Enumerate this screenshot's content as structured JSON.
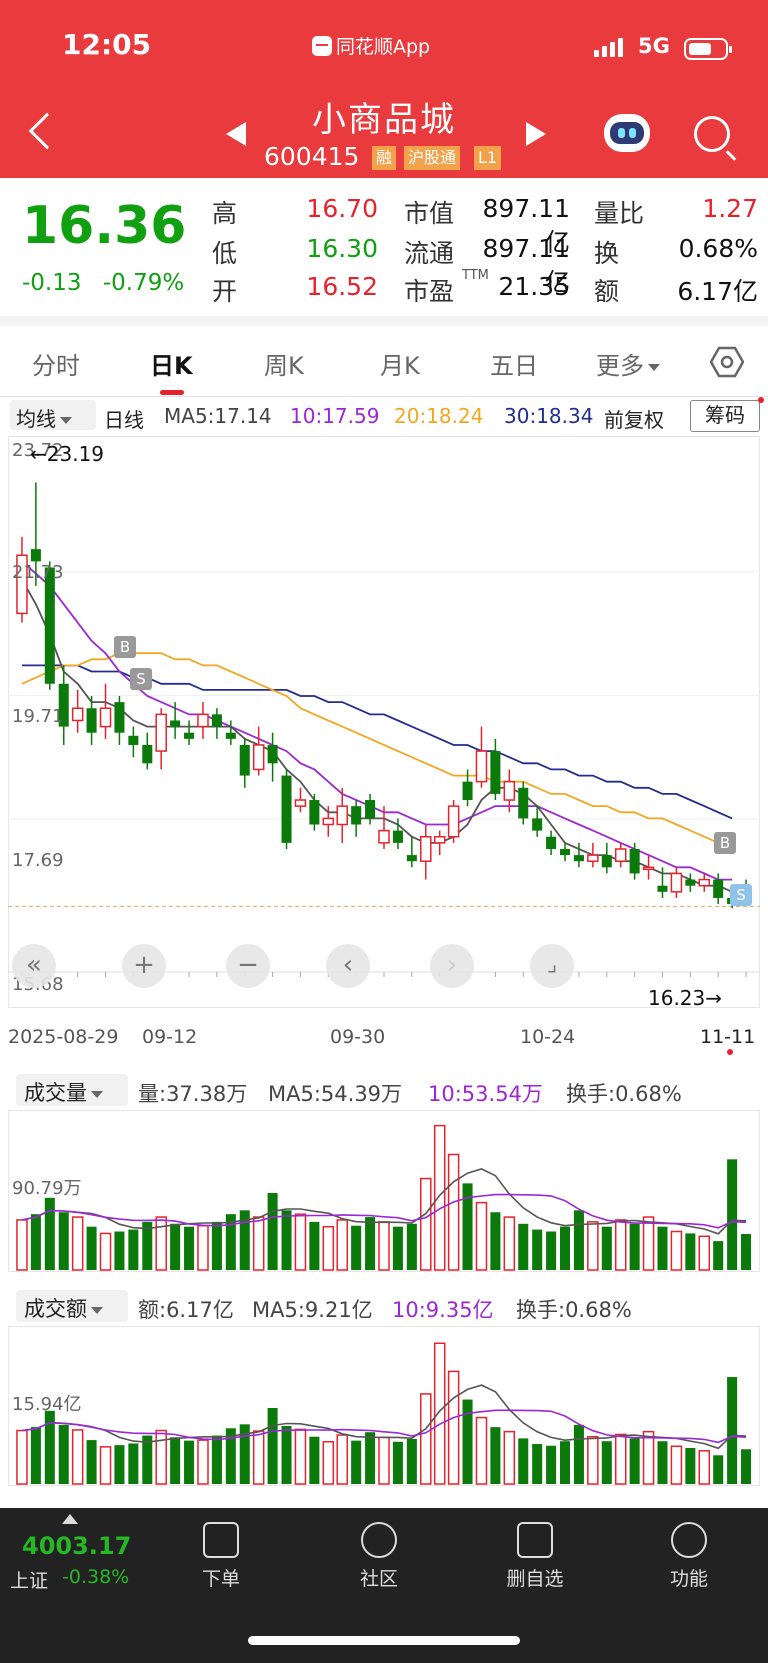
{
  "status": {
    "time": "12:05",
    "app": "同花顺App",
    "network": "5G"
  },
  "header": {
    "name": "小商品城",
    "code": "600415",
    "tags": [
      "融",
      "沪股通",
      "L1"
    ]
  },
  "quote": {
    "price": "16.36",
    "change": "-0.13",
    "pct": "-0.79%",
    "high_l": "高",
    "high": "16.70",
    "low_l": "低",
    "low": "16.30",
    "open_l": "开",
    "open": "16.52",
    "mcap_l": "市值",
    "mcap": "897.11亿",
    "float_l": "流通",
    "float": "897.11亿",
    "pe_l": "市盈",
    "pe_sup": "TTM",
    "pe": "21.35",
    "vr_l": "量比",
    "vr": "1.27",
    "turn_l": "换",
    "turn": "0.68%",
    "amt_l": "额",
    "amt": "6.17亿"
  },
  "tabs": [
    "分时",
    "日K",
    "周K",
    "月K",
    "五日",
    "更多"
  ],
  "ma": {
    "dd": "均线",
    "kind": "日线",
    "ma5": "MA5:17.14",
    "ma10": "10:17.59",
    "ma20": "20:18.24",
    "ma30": "30:18.34",
    "adj": "前复权",
    "chip": "筹码"
  },
  "colors": {
    "up": "#e8222d",
    "down": "#0b7a0b",
    "ma5": "#555555",
    "ma10": "#9b27d6",
    "ma20": "#f2a722",
    "ma30": "#232c8f"
  },
  "kchart": {
    "ymax": "23.72",
    "y21": "21.73",
    "y19": "19.71",
    "y17": "17.69",
    "y15": "15.68",
    "high_mark": "←23.19",
    "low_mark": "16.23→",
    "dates": [
      "2025-08-29",
      "09-12",
      "09-30",
      "10-24",
      "11-11"
    ],
    "marks": [
      "B",
      "S"
    ]
  },
  "volume": {
    "dd": "成交量",
    "vol": "量:37.38万",
    "ma5": "MA5:54.39万",
    "ma10": "10:53.54万",
    "turn": "换手:0.68%",
    "ref": "90.79万"
  },
  "amount": {
    "dd": "成交额",
    "amt": "额:6.17亿",
    "ma5": "MA5:9.21亿",
    "ma10": "10:9.35亿",
    "turn": "换手:0.68%",
    "ref": "15.94亿"
  },
  "chart_data": {
    "type": "candlestick",
    "ylim": [
      15.68,
      23.72
    ],
    "x_ticks": [
      "2025-08-29",
      "09-12",
      "09-30",
      "10-24",
      "11-11"
    ],
    "candles": [
      [
        21.05,
        22.0,
        22.3,
        20.9
      ],
      [
        22.1,
        21.9,
        23.19,
        21.5
      ],
      [
        21.8,
        19.9,
        21.9,
        19.8
      ],
      [
        19.9,
        19.2,
        20.2,
        18.9
      ],
      [
        19.3,
        19.5,
        19.8,
        19.1
      ],
      [
        19.5,
        19.1,
        19.7,
        18.9
      ],
      [
        19.2,
        19.5,
        19.9,
        19.0
      ],
      [
        19.6,
        19.1,
        19.7,
        18.9
      ],
      [
        19.05,
        18.9,
        19.2,
        18.7
      ],
      [
        18.9,
        18.6,
        19.1,
        18.5
      ],
      [
        18.8,
        19.4,
        19.5,
        18.5
      ],
      [
        19.3,
        19.2,
        19.6,
        19.0
      ],
      [
        19.1,
        19.0,
        19.3,
        18.9
      ],
      [
        19.2,
        19.4,
        19.6,
        19.0
      ],
      [
        19.4,
        19.2,
        19.5,
        19.0
      ],
      [
        19.1,
        19.0,
        19.3,
        18.9
      ],
      [
        18.9,
        18.4,
        19.0,
        18.2
      ],
      [
        18.5,
        18.9,
        19.2,
        18.4
      ],
      [
        18.9,
        18.6,
        19.1,
        18.3
      ],
      [
        18.4,
        17.3,
        18.5,
        17.2
      ],
      [
        17.9,
        18.0,
        18.2,
        17.8
      ],
      [
        18.0,
        17.6,
        18.1,
        17.5
      ],
      [
        17.6,
        17.7,
        17.9,
        17.4
      ],
      [
        17.6,
        17.9,
        18.2,
        17.3
      ],
      [
        17.9,
        17.6,
        18.0,
        17.4
      ],
      [
        18.0,
        17.7,
        18.1,
        17.6
      ],
      [
        17.3,
        17.5,
        17.9,
        17.2
      ],
      [
        17.5,
        17.3,
        17.7,
        17.2
      ],
      [
        17.1,
        17.0,
        17.4,
        16.9
      ],
      [
        17.0,
        17.4,
        17.6,
        16.7
      ],
      [
        17.3,
        17.4,
        17.5,
        17.1
      ],
      [
        17.4,
        17.9,
        18.0,
        17.3
      ],
      [
        18.3,
        18.0,
        18.5,
        17.9
      ],
      [
        18.3,
        18.8,
        19.2,
        18.2
      ],
      [
        18.8,
        18.1,
        19.0,
        18.0
      ],
      [
        18.0,
        18.3,
        18.5,
        17.8
      ],
      [
        18.2,
        17.7,
        18.3,
        17.6
      ],
      [
        17.7,
        17.5,
        17.9,
        17.4
      ],
      [
        17.4,
        17.2,
        17.5,
        17.1
      ],
      [
        17.2,
        17.1,
        17.3,
        17.0
      ],
      [
        17.1,
        17.0,
        17.3,
        16.9
      ],
      [
        17.0,
        17.1,
        17.3,
        16.9
      ],
      [
        17.1,
        16.9,
        17.3,
        16.8
      ],
      [
        17.0,
        17.2,
        17.3,
        16.9
      ],
      [
        17.2,
        16.8,
        17.3,
        16.7
      ],
      [
        16.9,
        16.9,
        17.1,
        16.7
      ],
      [
        16.6,
        16.5,
        16.9,
        16.4
      ],
      [
        16.5,
        16.8,
        16.9,
        16.4
      ],
      [
        16.7,
        16.6,
        16.8,
        16.5
      ],
      [
        16.6,
        16.7,
        16.8,
        16.5
      ],
      [
        16.7,
        16.4,
        16.8,
        16.3
      ],
      [
        16.4,
        16.3,
        16.5,
        16.23
      ],
      [
        16.52,
        16.36,
        16.7,
        16.3
      ]
    ],
    "ma5": [
      21.6,
      21.2,
      20.7,
      20.1,
      19.9,
      19.6,
      19.6,
      19.5,
      19.3,
      19.2,
      19.2,
      19.2,
      19.2,
      19.2,
      19.2,
      19.2,
      19.0,
      18.9,
      18.8,
      18.5,
      18.3,
      18.0,
      17.8,
      17.8,
      17.7,
      17.7,
      17.7,
      17.6,
      17.4,
      17.3,
      17.3,
      17.4,
      17.6,
      18.0,
      18.2,
      18.2,
      18.1,
      17.9,
      17.6,
      17.3,
      17.2,
      17.1,
      17.1,
      17.0,
      17.0,
      16.9,
      16.8,
      16.8,
      16.7,
      16.6,
      16.6,
      16.5,
      17.14
    ],
    "ma10": [
      21.9,
      21.7,
      21.5,
      21.2,
      20.9,
      20.6,
      20.4,
      20.1,
      19.9,
      19.7,
      19.6,
      19.5,
      19.4,
      19.4,
      19.3,
      19.2,
      19.1,
      19.0,
      18.9,
      18.8,
      18.6,
      18.5,
      18.3,
      18.1,
      18.0,
      17.9,
      17.8,
      17.8,
      17.7,
      17.6,
      17.6,
      17.6,
      17.7,
      17.8,
      17.9,
      17.9,
      17.9,
      17.9,
      17.8,
      17.7,
      17.6,
      17.5,
      17.4,
      17.3,
      17.2,
      17.1,
      17.0,
      16.9,
      16.9,
      16.8,
      16.7,
      16.7,
      17.59
    ],
    "ma20": [
      19.9,
      20.0,
      20.1,
      20.2,
      20.2,
      20.3,
      20.3,
      20.4,
      20.4,
      20.4,
      20.4,
      20.3,
      20.3,
      20.2,
      20.2,
      20.1,
      20.0,
      19.9,
      19.8,
      19.7,
      19.5,
      19.4,
      19.3,
      19.2,
      19.1,
      19.0,
      18.9,
      18.8,
      18.7,
      18.6,
      18.5,
      18.4,
      18.4,
      18.4,
      18.3,
      18.3,
      18.3,
      18.2,
      18.1,
      18.1,
      18.0,
      17.9,
      17.9,
      17.8,
      17.8,
      17.7,
      17.7,
      17.6,
      17.5,
      17.4,
      17.3,
      17.2,
      18.24
    ],
    "ma30": [
      20.2,
      20.2,
      20.2,
      20.2,
      20.2,
      20.1,
      20.1,
      20.1,
      20.0,
      20.0,
      19.9,
      19.9,
      19.9,
      19.8,
      19.8,
      19.8,
      19.8,
      19.8,
      19.8,
      19.8,
      19.7,
      19.7,
      19.6,
      19.6,
      19.5,
      19.4,
      19.4,
      19.3,
      19.2,
      19.1,
      19.0,
      18.9,
      18.9,
      18.8,
      18.8,
      18.7,
      18.6,
      18.6,
      18.5,
      18.5,
      18.4,
      18.4,
      18.3,
      18.3,
      18.2,
      18.2,
      18.1,
      18.1,
      18.0,
      17.9,
      17.8,
      17.7,
      18.34
    ],
    "volume": [
      52,
      58,
      75,
      60,
      55,
      45,
      38,
      40,
      42,
      50,
      55,
      48,
      45,
      46,
      50,
      58,
      62,
      55,
      80,
      62,
      58,
      50,
      45,
      52,
      46,
      55,
      50,
      45,
      48,
      95,
      150,
      120,
      90,
      70,
      60,
      55,
      48,
      42,
      40,
      45,
      62,
      50,
      45,
      52,
      48,
      55,
      45,
      40,
      38,
      35,
      30,
      115,
      37.38
    ],
    "amount": [
      9.5,
      10.1,
      13.0,
      10.5,
      9.6,
      7.8,
      6.6,
      6.9,
      7.2,
      8.6,
      9.5,
      8.3,
      7.7,
      7.8,
      8.6,
      9.9,
      10.6,
      9.4,
      13.5,
      10.3,
      9.7,
      8.4,
      7.5,
      8.7,
      7.7,
      9.2,
      8.3,
      7.5,
      8.0,
      16.0,
      25.0,
      20.0,
      15.0,
      11.8,
      10.1,
      9.3,
      8.1,
      7.1,
      6.8,
      7.6,
      10.5,
      8.4,
      7.6,
      8.8,
      8.1,
      9.3,
      7.6,
      6.7,
      6.4,
      5.9,
      5.1,
      19.0,
      6.17
    ]
  },
  "bottom": {
    "index": "4003.17",
    "index_name": "上证",
    "index_pct": "-0.38%",
    "items": [
      "下单",
      "社区",
      "删自选",
      "功能"
    ]
  }
}
